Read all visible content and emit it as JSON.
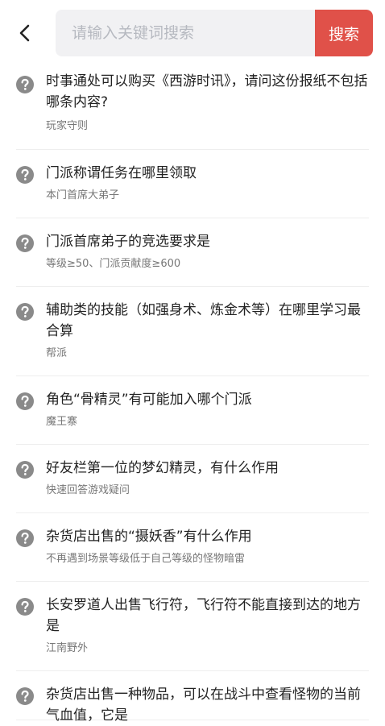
{
  "search": {
    "placeholder": "请输入关键词搜索",
    "button_label": "搜索"
  },
  "colors": {
    "accent": "#e05149",
    "icon_gray": "#8a8a8a"
  },
  "icons": {
    "back": "chevron-left-icon",
    "question": "question-circle-icon"
  },
  "items": [
    {
      "question": "时事通处可以购买《西游时讯》，请问这份报纸不包括哪条内容?",
      "answer": "玩家守则"
    },
    {
      "question": "门派称谓任务在哪里领取",
      "answer": "本门首席大弟子"
    },
    {
      "question": "门派首席弟子的竞选要求是",
      "answer": "等级≥50、门派贡献度≥600"
    },
    {
      "question": "辅助类的技能（如强身术、炼金术等）在哪里学习最合算",
      "answer": "帮派"
    },
    {
      "question": "角色“骨精灵”有可能加入哪个门派",
      "answer": "魔王寨"
    },
    {
      "question": "好友栏第一位的梦幻精灵，有什么作用",
      "answer": "快速回答游戏疑问"
    },
    {
      "question": "杂货店出售的“摄妖香”有什么作用",
      "answer": "不再遇到场景等级低于自己等级的怪物暗雷"
    },
    {
      "question": "长安罗道人出售飞行符，飞行符不能直接到达的地方是",
      "answer": "江南野外"
    },
    {
      "question": "杂货店出售一种物品，可以在战斗中查看怪物的当前气血值，它是",
      "answer": ""
    }
  ]
}
